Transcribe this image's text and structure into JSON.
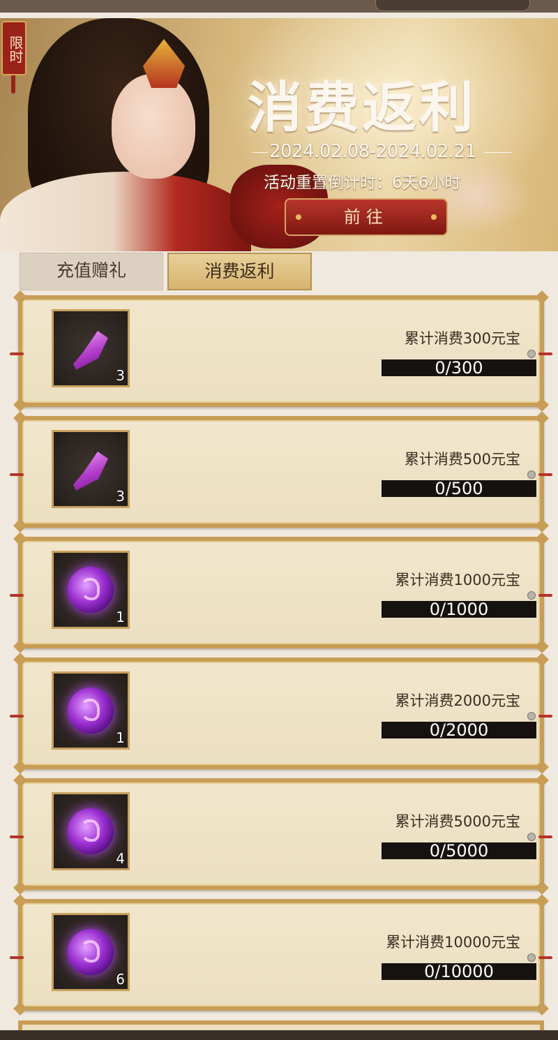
{
  "banner": {
    "tag": "限时",
    "title": "消费返利",
    "date_range": "2024.02.08-2024.02.21",
    "countdown": "活动重置倒计时：6天6小时",
    "go_button": "前往"
  },
  "tabs": [
    {
      "label": "充值赠礼",
      "active": false
    },
    {
      "label": "消费返利",
      "active": true
    }
  ],
  "rewards": [
    {
      "item": "purple-shard-icon",
      "count": "3",
      "requirement": "累计消费300元宝",
      "progress_text": "0/300",
      "progress": 0
    },
    {
      "item": "purple-shard-icon",
      "count": "3",
      "requirement": "累计消费500元宝",
      "progress_text": "0/500",
      "progress": 0
    },
    {
      "item": "purple-orb-icon",
      "count": "1",
      "requirement": "累计消费1000元宝",
      "progress_text": "0/1000",
      "progress": 0
    },
    {
      "item": "purple-orb-icon",
      "count": "1",
      "requirement": "累计消费2000元宝",
      "progress_text": "0/2000",
      "progress": 0
    },
    {
      "item": "purple-orb-icon",
      "count": "4",
      "requirement": "累计消费5000元宝",
      "progress_text": "0/5000",
      "progress": 0
    },
    {
      "item": "purple-orb-icon",
      "count": "6",
      "requirement": "累计消费10000元宝",
      "progress_text": "0/10000",
      "progress": 0
    }
  ],
  "colors": {
    "accent_gold": "#c89d55",
    "button_red": "#9b2219",
    "progress_track": "#161210"
  }
}
